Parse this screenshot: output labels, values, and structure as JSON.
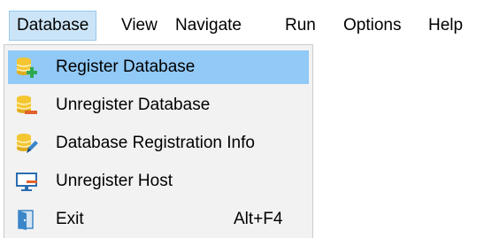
{
  "menubar": {
    "items": [
      {
        "label": "Database",
        "open": true
      },
      {
        "label": "View"
      },
      {
        "label": "Navigate"
      },
      {
        "label": "Run"
      },
      {
        "label": "Options"
      },
      {
        "label": "Help"
      }
    ]
  },
  "dropdown": {
    "items": [
      {
        "label": "Register Database",
        "icon": "database-add-icon",
        "highlighted": true
      },
      {
        "label": "Unregister Database",
        "icon": "database-remove-icon"
      },
      {
        "label": "Database Registration Info",
        "icon": "database-edit-icon"
      },
      {
        "label": "Unregister Host",
        "icon": "monitor-icon"
      },
      {
        "label": "Exit",
        "icon": "exit-icon",
        "shortcut": "Alt+F4"
      }
    ]
  },
  "colors": {
    "menubar_open_bg": "#cce4f7",
    "highlight_bg": "#91c9f7",
    "dropdown_bg": "#f2f2f2",
    "database_icon": "#f3c632",
    "add_icon": "#2da94f",
    "remove_icon": "#e2622e",
    "monitor_icon": "#2b6cb0",
    "exit_icon": "#3a86c8"
  }
}
